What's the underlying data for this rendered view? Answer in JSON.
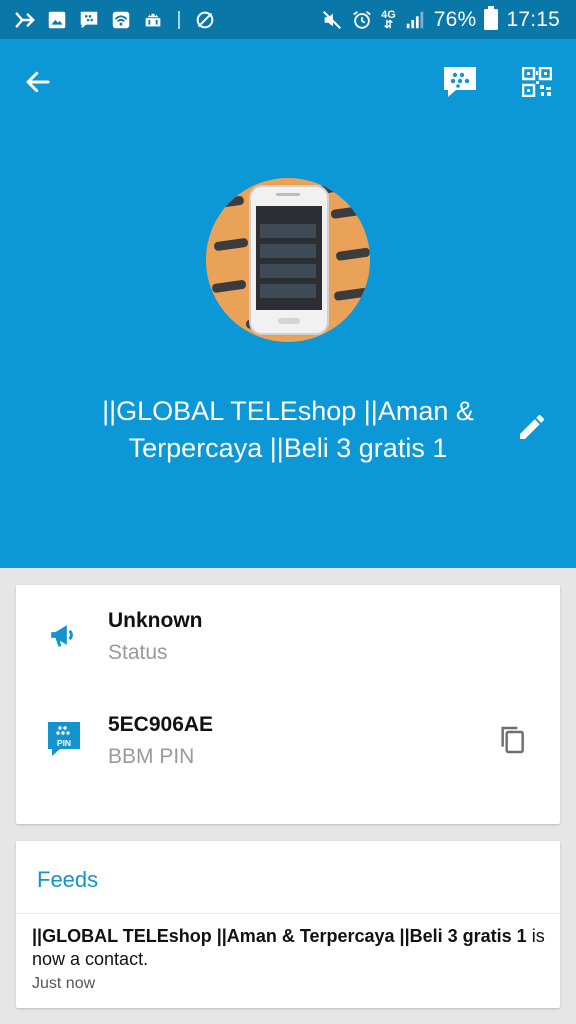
{
  "status_bar": {
    "battery_percent": "76%",
    "time": "17:15",
    "network": "4G",
    "icons_left": [
      "kaskus-icon",
      "gallery-icon",
      "bbm-notification-icon",
      "wifi-icon",
      "android-debug-icon",
      "data-saver-icon"
    ],
    "icons_right": [
      "mute-icon",
      "alarm-icon",
      "signal-icon",
      "battery-icon"
    ]
  },
  "header": {
    "background_color": "#0c97d6",
    "display_name": "||GLOBAL TELEshop  ||Aman & Terpercaya  ||Beli 3 gratis 1"
  },
  "info_card": {
    "status_value": "Unknown",
    "status_label": "Status",
    "pin_value": "5EC906AE",
    "pin_label": "BBM PIN",
    "pin_icon_text": "PIN",
    "accent_color": "#1394cf"
  },
  "feeds": {
    "title": "Feeds",
    "item_name": "||GLOBAL TELEshop ||Aman & Terpercaya ||Beli 3 gratis 1",
    "item_message": "is now a contact.",
    "item_time": "Just now"
  }
}
